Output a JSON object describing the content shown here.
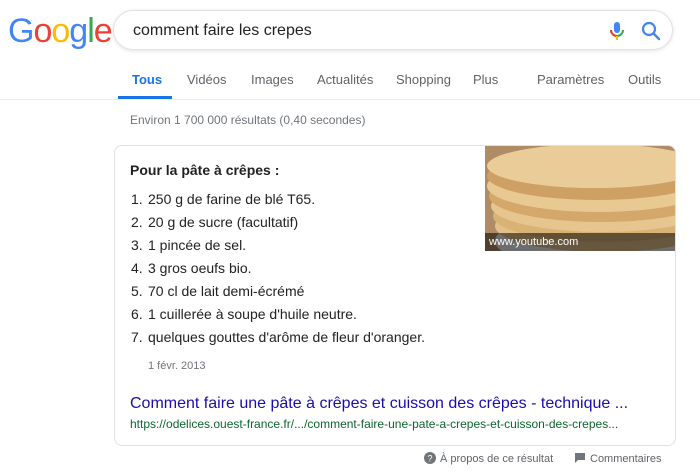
{
  "logo": {
    "letters": [
      "G",
      "o",
      "o",
      "g",
      "l",
      "e"
    ],
    "colors": [
      "#4285f4",
      "#ea4335",
      "#fbbc05",
      "#4285f4",
      "#34a853",
      "#ea4335"
    ]
  },
  "search": {
    "query": "comment faire les crepes"
  },
  "tabs": [
    "Tous",
    "Vidéos",
    "Images",
    "Actualités",
    "Shopping",
    "Plus",
    "Paramètres",
    "Outils"
  ],
  "stats": "Environ 1 700 000 résultats (0,40 secondes)",
  "snippet": {
    "heading": "Pour la pâte à crêpes :",
    "items": [
      {
        "num": "1.",
        "text": "250 g de farine de blé T65."
      },
      {
        "num": "2.",
        "text": "20 g de sucre (facultatif)"
      },
      {
        "num": "3.",
        "text": "1 pincée de sel."
      },
      {
        "num": "4.",
        "text": "3 gros oeufs bio."
      },
      {
        "num": "5.",
        "text": "70 cl de lait demi-écrémé"
      },
      {
        "num": "6.",
        "text": "1 cuillerée à soupe d'huile neutre."
      },
      {
        "num": "7.",
        "text": "quelques gouttes d'arôme de fleur d'oranger."
      }
    ],
    "date": "1 févr. 2013",
    "result_title": "Comment faire une pâte à crêpes et cuisson des crêpes - technique ...",
    "result_url": "https://odelices.ouest-france.fr/.../comment-faire-une-pate-a-crepes-et-cuisson-des-crepes...",
    "thumbnail_caption": "www.youtube.com"
  },
  "footer": {
    "about": "À propos de ce résultat",
    "feedback": "Commentaires"
  },
  "colors": {
    "link": "#1a0dab",
    "url": "#0d652d",
    "accent": "#1a73e8"
  }
}
